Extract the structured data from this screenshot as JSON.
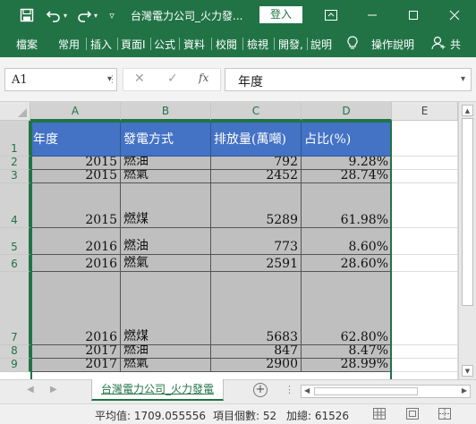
{
  "window": {
    "document_title": "台灣電力公司_火力發...",
    "login_button": "登入",
    "colors": {
      "accent": "#217346",
      "table_header": "#4472c4",
      "table_fill": "#bfbfbf"
    },
    "icons": [
      "save-icon",
      "undo-icon",
      "redo-icon",
      "customize-qat-icon",
      "ribbon-display-icon",
      "minimize-icon",
      "maximize-icon",
      "close-icon"
    ]
  },
  "ribbon": {
    "tabs": [
      "檔案",
      "常用",
      "插入",
      "頁面I",
      "公式",
      "資料",
      "校閱",
      "檢視",
      "開發,",
      "說明"
    ],
    "tell_me": "操作說明",
    "share": "共"
  },
  "formula_bar": {
    "name_box": "A1",
    "formula": "年度",
    "fx_label": "fx"
  },
  "grid": {
    "columns": [
      "A",
      "B",
      "C",
      "D",
      "E"
    ],
    "row_labels": [
      "1",
      "2",
      "3",
      "4",
      "5",
      "6",
      "7",
      "8",
      "9"
    ],
    "header": [
      "年度",
      "發電方式",
      "排放量(萬噸)",
      "占比(%)"
    ],
    "rows": [
      [
        "2015",
        "燃油",
        "792",
        "9.28%"
      ],
      [
        "2015",
        "燃氣",
        "2452",
        "28.74%"
      ],
      [
        "2015",
        "燃煤",
        "5289",
        "61.98%"
      ],
      [
        "2016",
        "燃油",
        "773",
        "8.60%"
      ],
      [
        "2016",
        "燃氣",
        "2591",
        "28.60%"
      ],
      [
        "2016",
        "燃煤",
        "5683",
        "62.80%"
      ],
      [
        "2017",
        "燃油",
        "847",
        "8.47%"
      ],
      [
        "2017",
        "燃氣",
        "2900",
        "28.99%"
      ]
    ]
  },
  "sheet_tabs": {
    "active": "台灣電力公司_火力發電",
    "add_symbol": "+"
  },
  "status_bar": {
    "average": "平均值: 1709.055556",
    "count": "項目個數: 52",
    "sum": "加總: 61526"
  }
}
